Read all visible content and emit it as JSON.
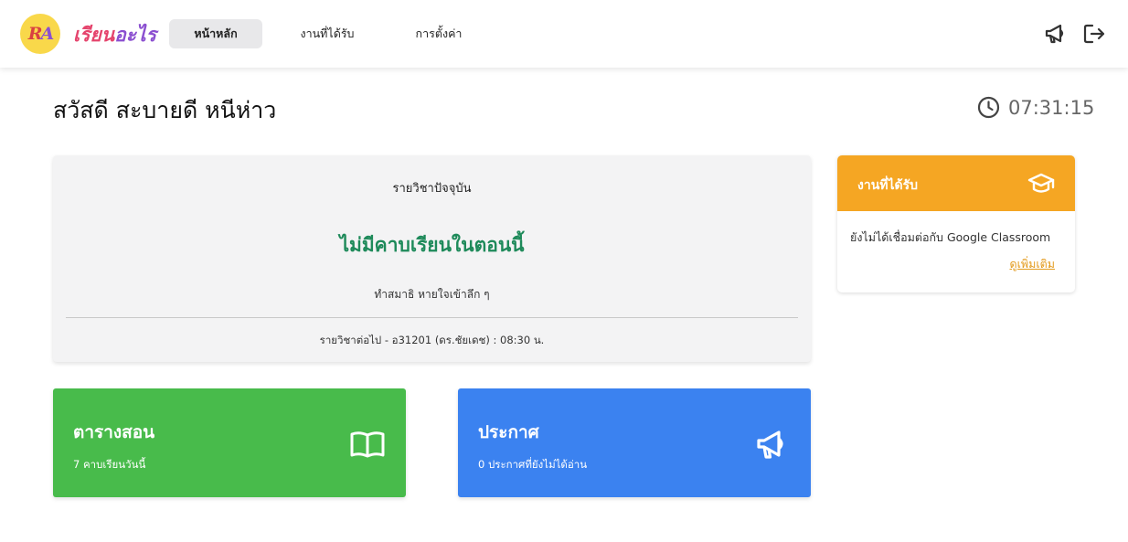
{
  "brand": {
    "logo_text": "RA",
    "name_part1": "เรียน",
    "name_part2": "อะไร"
  },
  "nav": {
    "items": [
      {
        "label": "หน้าหลัก",
        "active": true
      },
      {
        "label": "งานที่ได้รับ",
        "active": false
      },
      {
        "label": "การตั้งค่า",
        "active": false
      }
    ],
    "icons": [
      "megaphone-icon",
      "logout-icon"
    ]
  },
  "greeting": "สวัสดี สะบายดี หนีห่าว",
  "clock": {
    "icon": "clock-icon",
    "time": "07:31:15"
  },
  "current_subject": {
    "title": "รายวิชาปัจจุบัน",
    "status": "ไม่มีคาบเรียนในตอนนี้",
    "message": "ทำสมาธิ หายใจเข้าลึก ๆ",
    "next": "รายวิชาต่อไป - อ31201 (ดร.ชัยเดช) : 08:30 น."
  },
  "tiles": [
    {
      "title": "ตารางสอน",
      "subtitle": "7 คาบเรียนวันนี้",
      "icon": "book-icon",
      "color": "#48bb4b"
    },
    {
      "title": "ประกาศ",
      "subtitle": "0 ประกาศที่ยังไม่ได้อ่าน",
      "icon": "megaphone-icon",
      "color": "#3b82f0"
    }
  ],
  "assignments": {
    "title": "งานที่ได้รับ",
    "icon": "graduation-cap-icon",
    "text": "ยังไม่ได้เชื่อมต่อกับ Google Classroom",
    "link": "ดูเพิ่มเติม",
    "color": "#f5a623"
  }
}
